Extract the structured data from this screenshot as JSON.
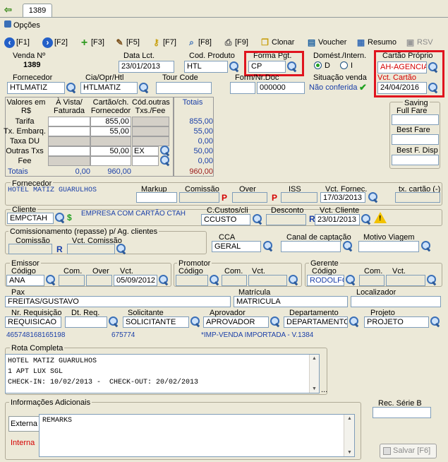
{
  "tab": {
    "label": "1389"
  },
  "options_label": "Opções",
  "toolbar": {
    "f1": "[F1]",
    "f2": "[F2]",
    "f3": "[F3]",
    "f5": "[F5]",
    "f7": "[F7]",
    "f8": "[F8]",
    "f9": "[F9]",
    "clonar": "Clonar",
    "voucher": "Voucher",
    "resumo": "Resumo",
    "rsv": "RSV"
  },
  "venda": {
    "label": "Venda Nº",
    "value": "1389"
  },
  "data_lct": {
    "label": "Data Lct.",
    "value": "23/01/2013"
  },
  "cod_produto": {
    "label": "Cod. Produto",
    "value": "HTL"
  },
  "forma_pgt": {
    "label": "Forma Pgt.",
    "value": "CP"
  },
  "domestico": {
    "label": "Domést./Intern.",
    "opt_d": "D",
    "opt_i": "I"
  },
  "cartao_proprio": {
    "label": "Cartão Próprio",
    "value": "AH-AGENCIA",
    "vct_label": "Vct. Cartão",
    "vct_value": "24/04/2016"
  },
  "fornecedor": {
    "label": "Fornecedor",
    "value": "HTLMATIZ"
  },
  "cia": {
    "label": "Cia/Opr/Htl",
    "value": "HTLMATIZ"
  },
  "tour_code": {
    "label": "Tour Code",
    "value": ""
  },
  "form_nr_doc": {
    "label": "Form/Nr.Doc",
    "value": "000000"
  },
  "situacao": {
    "label": "Situação venda",
    "value": "Não conferida"
  },
  "grid": {
    "h0": "Valores em R$",
    "h1": "À Vista/ Faturada",
    "h2": "Cartão/ch. Fornecedor",
    "h3": "Cód.outras Txs./Fee",
    "h4": "Totais",
    "rows": [
      {
        "label": "Tarifa",
        "c2": "855,00",
        "tot": "855,00"
      },
      {
        "label": "Tx. Embarq.",
        "c2": "55,00",
        "tot": "55,00"
      },
      {
        "label": "Taxa DU",
        "c2": "",
        "tot": "0,00"
      },
      {
        "label": "Outras Txs",
        "c2": "50,00",
        "code": "EX",
        "tot": "50,00"
      },
      {
        "label": "Fee",
        "c2": "",
        "tot": "0,00"
      }
    ],
    "totais_label": "Totais",
    "tot_c1": "0,00",
    "tot_c2": "960,00",
    "tot_total": "960,00"
  },
  "saving": {
    "label": "Saving",
    "full_fare": "Full Fare",
    "best_fare": "Best Fare",
    "best_f_disp": "Best F. Disp"
  },
  "fornecedor2": {
    "label": "Fornecedor",
    "value": "HOTEL MATIZ GUARULHOS"
  },
  "markup": {
    "label": "Markup"
  },
  "comissao": {
    "label": "Comissão"
  },
  "over": {
    "label": "Over"
  },
  "iss": {
    "label": "ISS"
  },
  "vct_fornec": {
    "label": "Vct. Fornec.",
    "value": "17/03/2013"
  },
  "tx_cartao": {
    "label": "tx. cartão (-)"
  },
  "cliente": {
    "label": "Cliente",
    "value": "EMPCTAH",
    "desc": "EMPRESA COM CARTÃO CTAH"
  },
  "ccustos": {
    "label": "C.Custos/cli",
    "value": "CCUSTO"
  },
  "desconto": {
    "label": "Desconto"
  },
  "vct_cliente": {
    "label": "Vct. Cliente",
    "value": "23/01/2013"
  },
  "comissionamento": {
    "label": "Comissionamento (repasse) p/ Ag. clientes",
    "comissao": "Comissão",
    "vct": "Vct. Comissão"
  },
  "cca": {
    "label": "CCA",
    "value": "GERAL"
  },
  "canal": {
    "label": "Canal de captação"
  },
  "motivo": {
    "label": "Motivo Viagem"
  },
  "emissor": {
    "label": "Emissor",
    "codigo": "Código",
    "com": "Com.",
    "over": "Over",
    "vct": "Vct.",
    "value": "ANA",
    "vct_value": "05/09/2012"
  },
  "promotor": {
    "label": "Promotor",
    "codigo": "Código",
    "com": "Com.",
    "vct": "Vct."
  },
  "gerente": {
    "label": "Gerente",
    "codigo": "Código",
    "com": "Com.",
    "vct": "Vct.",
    "value": "RODOLFO"
  },
  "pax": {
    "label": "Pax",
    "value": "FREITAS/GUSTAVO"
  },
  "matricula": {
    "label": "Matrícula",
    "value": "MATRICULA"
  },
  "localizador": {
    "label": "Localizador"
  },
  "nr_req": {
    "label": "Nr. Requisição",
    "value": "REQUISICAO"
  },
  "dt_req": {
    "label": "Dt. Req."
  },
  "solicitante": {
    "label": "Solicitante",
    "value": "SOLICITANTE"
  },
  "aprovador": {
    "label": "Aprovador",
    "value": "APROVADOR"
  },
  "departamento": {
    "label": "Departamento",
    "value": "DEPARTAMENTO"
  },
  "projeto": {
    "label": "Projeto",
    "value": "PROJETO"
  },
  "info_line": {
    "a": "465748168165198",
    "b": "675774",
    "c": "*IMP-VENDA IMPORTADA - V.1384"
  },
  "rota": {
    "label": "Rota Completa",
    "l1": "HOTEL MATIZ GUARULHOS",
    "l2": "1 APT LUX SGL",
    "l3": "CHECK-IN: 10/02/2013 -  CHECK-OUT: 20/02/2013"
  },
  "info_adic": {
    "label": "Informações Adicionais",
    "externa": "Externa",
    "interna": "Interna",
    "remarks": "REMARKS"
  },
  "rec_serie": {
    "label": "Rec. Série B"
  },
  "salvar": {
    "label": "Salvar [F6]"
  },
  "buttons": {
    "r": "R",
    "p": "P",
    "dollar": "$",
    "ellipsis": "..."
  },
  "colors": {
    "accent_red": "#e0141e",
    "blue_text": "#1a3fa8"
  }
}
